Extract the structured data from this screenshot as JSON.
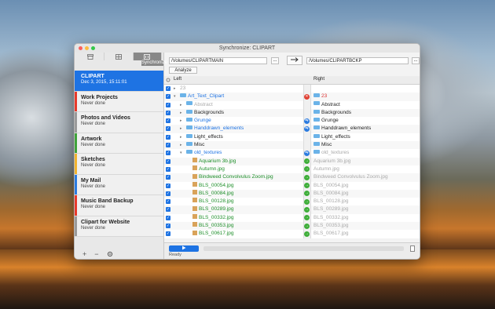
{
  "window": {
    "title": "Synchronize: CLIPART"
  },
  "sidebar": {
    "tabs": [
      {
        "icon": "archive-icon"
      },
      {
        "icon": "grid-icon"
      },
      {
        "icon": "sync-icon"
      }
    ],
    "tab_caption": "Synchronize",
    "tasks": [
      {
        "name": "CLIPART",
        "status": "Dec 3, 2015, 15:11:01",
        "color": "#1e73e3",
        "selected": true
      },
      {
        "name": "Work Projects",
        "status": "Never done",
        "color": "#e8392b"
      },
      {
        "name": "Photos and Videos",
        "status": "Never done",
        "color": "#9a9a9a"
      },
      {
        "name": "Artwork",
        "status": "Never done",
        "color": "#3fa33b"
      },
      {
        "name": "Sketches",
        "status": "Never done",
        "color": "#f1b42f"
      },
      {
        "name": "My Mail",
        "status": "Never done",
        "color": "#2b7be0"
      },
      {
        "name": "Music Band Backup",
        "status": "Never done",
        "color": "#e8392b"
      },
      {
        "name": "Clipart for Website",
        "status": "Never done",
        "color": "#9a9a9a"
      }
    ],
    "footer": {
      "add": "+",
      "remove": "−"
    }
  },
  "main": {
    "left_path": "/Volumes/CLIPARTMAIN",
    "right_path": "/Volumes/CLIPARTBCKP",
    "browse_label": "...",
    "analyze_label": "Analyze",
    "left_header": "Left",
    "right_header": "Right",
    "rows": [
      {
        "left": "23",
        "lclass": "gray",
        "tri": "▸",
        "lkind": "none",
        "action": "",
        "right": "",
        "rclass": "",
        "rkind": "none",
        "indent": 0
      },
      {
        "left": "Art_Text_Clipart",
        "lclass": "blue",
        "tri": "▾",
        "lkind": "folder",
        "action": "x",
        "right": "23",
        "rclass": "red",
        "rkind": "folder",
        "indent": 0
      },
      {
        "left": "Abstract",
        "lclass": "gray",
        "tri": "▸",
        "lkind": "folder",
        "action": "",
        "right": "Abstract",
        "rclass": "dark",
        "rkind": "folder",
        "indent": 1
      },
      {
        "left": "Backgrounds",
        "lclass": "dark",
        "tri": "▸",
        "lkind": "folder",
        "action": "",
        "right": "Backgrounds",
        "rclass": "dark",
        "rkind": "folder",
        "indent": 1
      },
      {
        "left": "Grunge",
        "lclass": "blue",
        "tri": "▸",
        "lkind": "folder",
        "action": "s",
        "right": "Grunge",
        "rclass": "dark",
        "rkind": "folder",
        "indent": 1
      },
      {
        "left": "Handdrawn_elements",
        "lclass": "blue",
        "tri": "▸",
        "lkind": "folder",
        "action": "s",
        "right": "Handdrawn_elements",
        "rclass": "dark",
        "rkind": "folder",
        "indent": 1
      },
      {
        "left": "Light_effects",
        "lclass": "dark",
        "tri": "▸",
        "lkind": "folder",
        "action": "",
        "right": "Light_effects",
        "rclass": "dark",
        "rkind": "folder",
        "indent": 1
      },
      {
        "left": "Misc",
        "lclass": "dark",
        "tri": "▸",
        "lkind": "folder",
        "action": "",
        "right": "Misc",
        "rclass": "dark",
        "rkind": "folder",
        "indent": 1
      },
      {
        "left": "old_textures",
        "lclass": "blue",
        "tri": "▾",
        "lkind": "folder",
        "action": "s",
        "right": "old_textures",
        "rclass": "gray",
        "rkind": "folder",
        "indent": 1
      },
      {
        "left": "Aquarium 3b.jpg",
        "lclass": "green",
        "tri": "",
        "lkind": "file",
        "action": "a",
        "right": "Aquarium 3b.jpg",
        "rclass": "gray",
        "rkind": "none",
        "indent": 2
      },
      {
        "left": "Autumn.jpg",
        "lclass": "green",
        "tri": "",
        "lkind": "file",
        "action": "a",
        "right": "Autumn.jpg",
        "rclass": "gray",
        "rkind": "none",
        "indent": 2
      },
      {
        "left": "Bindweed Convolvulus Zoom.jpg",
        "lclass": "green",
        "tri": "",
        "lkind": "file",
        "action": "a",
        "right": "Bindweed Convolvulus Zoom.jpg",
        "rclass": "gray",
        "rkind": "none",
        "indent": 2
      },
      {
        "left": "BLS_00054.jpg",
        "lclass": "green",
        "tri": "",
        "lkind": "file",
        "action": "a",
        "right": "BLS_00054.jpg",
        "rclass": "gray",
        "rkind": "none",
        "indent": 2
      },
      {
        "left": "BLS_00084.jpg",
        "lclass": "green",
        "tri": "",
        "lkind": "file",
        "action": "a",
        "right": "BLS_00084.jpg",
        "rclass": "gray",
        "rkind": "none",
        "indent": 2
      },
      {
        "left": "BLS_00128.jpg",
        "lclass": "green",
        "tri": "",
        "lkind": "file",
        "action": "a",
        "right": "BLS_00128.jpg",
        "rclass": "gray",
        "rkind": "none",
        "indent": 2
      },
      {
        "left": "BLS_00289.jpg",
        "lclass": "green",
        "tri": "",
        "lkind": "file",
        "action": "a",
        "right": "BLS_00289.jpg",
        "rclass": "gray",
        "rkind": "none",
        "indent": 2
      },
      {
        "left": "BLS_00332.jpg",
        "lclass": "green",
        "tri": "",
        "lkind": "file",
        "action": "a",
        "right": "BLS_00332.jpg",
        "rclass": "gray",
        "rkind": "none",
        "indent": 2
      },
      {
        "left": "BLS_00353.jpg",
        "lclass": "green",
        "tri": "",
        "lkind": "file",
        "action": "a",
        "right": "BLS_00353.jpg",
        "rclass": "gray",
        "rkind": "none",
        "indent": 2
      },
      {
        "left": "BLS_00617.jpg",
        "lclass": "green",
        "tri": "",
        "lkind": "file",
        "action": "a",
        "right": "BLS_00617.jpg",
        "rclass": "gray",
        "rkind": "none",
        "indent": 2
      }
    ],
    "status": "Ready",
    "play_icon": "play-icon"
  },
  "colors": {
    "accent": "#1e73e3",
    "skip": "#2b7be0",
    "add": "#3fae3a",
    "delete": "#e04134"
  }
}
